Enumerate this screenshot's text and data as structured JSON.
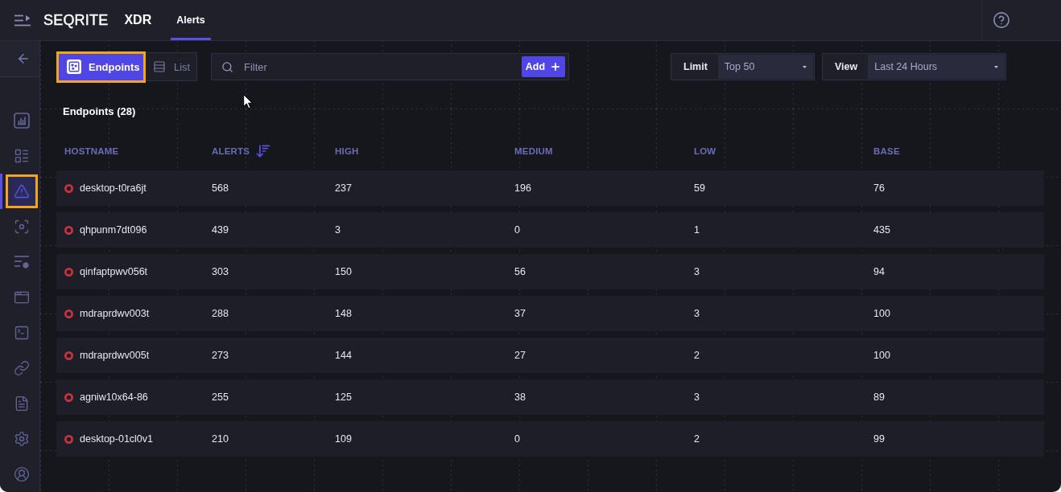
{
  "header": {
    "logo": "SEQRITE",
    "product": "XDR",
    "tabs": [
      {
        "label": "Alerts",
        "selected": true
      }
    ]
  },
  "sidebar": {
    "items": [
      {
        "selected": false,
        "highlighted": false
      },
      {
        "selected": false,
        "highlighted": false
      },
      {
        "selected": true,
        "highlighted": true
      },
      {
        "selected": false,
        "highlighted": false
      },
      {
        "selected": false,
        "highlighted": false
      },
      {
        "selected": false,
        "highlighted": false
      },
      {
        "selected": false,
        "highlighted": false
      },
      {
        "selected": false,
        "highlighted": false
      },
      {
        "selected": false,
        "highlighted": false
      },
      {
        "selected": false,
        "highlighted": false
      },
      {
        "selected": false,
        "highlighted": false
      }
    ]
  },
  "toolbar": {
    "view_toggle": [
      {
        "label": "Endpoints",
        "selected": true,
        "highlighted": true
      },
      {
        "label": "List",
        "selected": false,
        "highlighted": false
      }
    ],
    "filter": {
      "placeholder": "Filter",
      "add_button": "Add"
    },
    "limit": {
      "label": "Limit",
      "value": "Top 50"
    },
    "view": {
      "label": "View",
      "value": "Last 24 Hours"
    }
  },
  "table": {
    "title": "Endpoints (28)",
    "columns": [
      {
        "label": "HOSTNAME",
        "sorted": false
      },
      {
        "label": "ALERTS",
        "sorted": true
      },
      {
        "label": "HIGH",
        "sorted": false
      },
      {
        "label": "MEDIUM",
        "sorted": false
      },
      {
        "label": "LOW",
        "sorted": false
      },
      {
        "label": "BASE",
        "sorted": false
      }
    ],
    "rows": [
      [
        "desktop-t0ra6jt",
        "568",
        "237",
        "196",
        "59",
        "76"
      ],
      [
        "qhpunm7dt096",
        "439",
        "3",
        "0",
        "1",
        "435"
      ],
      [
        "qinfaptpwv056t",
        "303",
        "150",
        "56",
        "3",
        "94"
      ],
      [
        "mdraprdwv003t",
        "288",
        "148",
        "37",
        "3",
        "100"
      ],
      [
        "mdraprdwv005t",
        "273",
        "144",
        "27",
        "2",
        "100"
      ],
      [
        "agniw10x64-86",
        "255",
        "125",
        "38",
        "3",
        "89"
      ],
      [
        "desktop-01cl0v1",
        "210",
        "109",
        "0",
        "2",
        "99"
      ]
    ]
  }
}
